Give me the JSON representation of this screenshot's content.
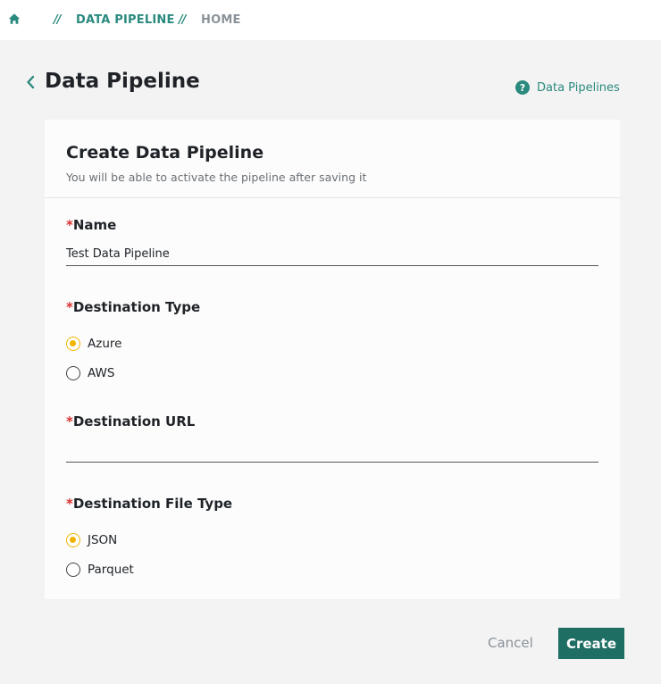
{
  "breadcrumb": {
    "separator": "//",
    "items": [
      {
        "label": "DATA PIPELINE"
      },
      {
        "label": "HOME"
      }
    ]
  },
  "header": {
    "title": "Data Pipeline",
    "help_label": "Data Pipelines",
    "help_glyph": "?"
  },
  "form": {
    "title": "Create Data Pipeline",
    "subtitle": "You will be able to activate the pipeline after saving it",
    "required_marker": "*",
    "name": {
      "label": "Name",
      "value": "Test Data Pipeline"
    },
    "destination_type": {
      "label": "Destination Type",
      "options": [
        {
          "label": "Azure",
          "selected": true
        },
        {
          "label": "AWS",
          "selected": false
        }
      ]
    },
    "destination_url": {
      "label": "Destination URL",
      "value": ""
    },
    "destination_file_type": {
      "label": "Destination File Type",
      "options": [
        {
          "label": "JSON",
          "selected": true
        },
        {
          "label": "Parquet",
          "selected": false
        }
      ]
    }
  },
  "actions": {
    "cancel_label": "Cancel",
    "create_label": "Create"
  },
  "colors": {
    "accent": "#2b8a7e",
    "primary_button": "#1f6e64",
    "radio_selected": "#f0b400",
    "required": "#d93030"
  }
}
